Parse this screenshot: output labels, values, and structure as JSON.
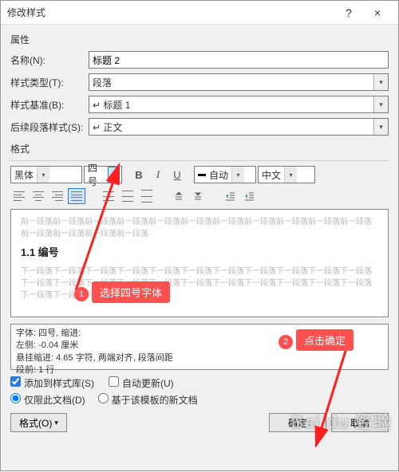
{
  "titlebar": {
    "title": "修改样式",
    "helpGlyph": "?",
    "closeGlyph": "×"
  },
  "sections": {
    "properties": "属性",
    "format": "格式"
  },
  "labels": {
    "name": "名称(N):",
    "styleType": "样式类型(T):",
    "styleBase": "样式基准(B):",
    "followStyle": "后续段落样式(S):"
  },
  "values": {
    "name": "标题 2",
    "styleType": "段落",
    "styleBase": "↵ 标题 1",
    "followStyle": "↵ 正文"
  },
  "format": {
    "font": "黑体",
    "size": "四号",
    "color": "自动",
    "lang": "中文"
  },
  "preview": {
    "lorem1": "前一段落前一段落前一段落前一段落前一段落前一段落前一段落前一段落前一段落前一段落前一段落前一段落前一段落前一段落前一段落",
    "heading": "1.1 编号",
    "lorem2": "下一段落下一段落下一段落下一段落下一段落下一段落下一段落下一段落下一段落下一段落下一段落下一段落下一段落下一段落下一段落下一段落下一段落下一段落下一段落下一段落下一段落下一段落下一段落下一段落下一段落"
  },
  "description": {
    "l1": "字体: 四号, 缩进:",
    "l2": "  左侧:  -0.04 厘米",
    "l3": "  悬挂缩进: 4.65 字符, 两端对齐, 段落间距",
    "l4": "  段前: 1 行"
  },
  "checks": {
    "addToGallery": "添加到样式库(S)",
    "autoUpdate": "自动更新(U)"
  },
  "radios": {
    "onlyDoc": "仅限此文档(D)",
    "template": "基于该模板的新文档"
  },
  "buttons": {
    "format": "格式(O)",
    "ok": "确定",
    "cancel": "取消"
  },
  "annotations": {
    "a1num": "1",
    "a1text": "选择四号字体",
    "a2num": "2",
    "a2text": "点击确定"
  },
  "watermark": "Bai du 经验",
  "glyphs": {
    "dd": "▾",
    "bold": "B",
    "italic": "I",
    "underline": "U"
  }
}
